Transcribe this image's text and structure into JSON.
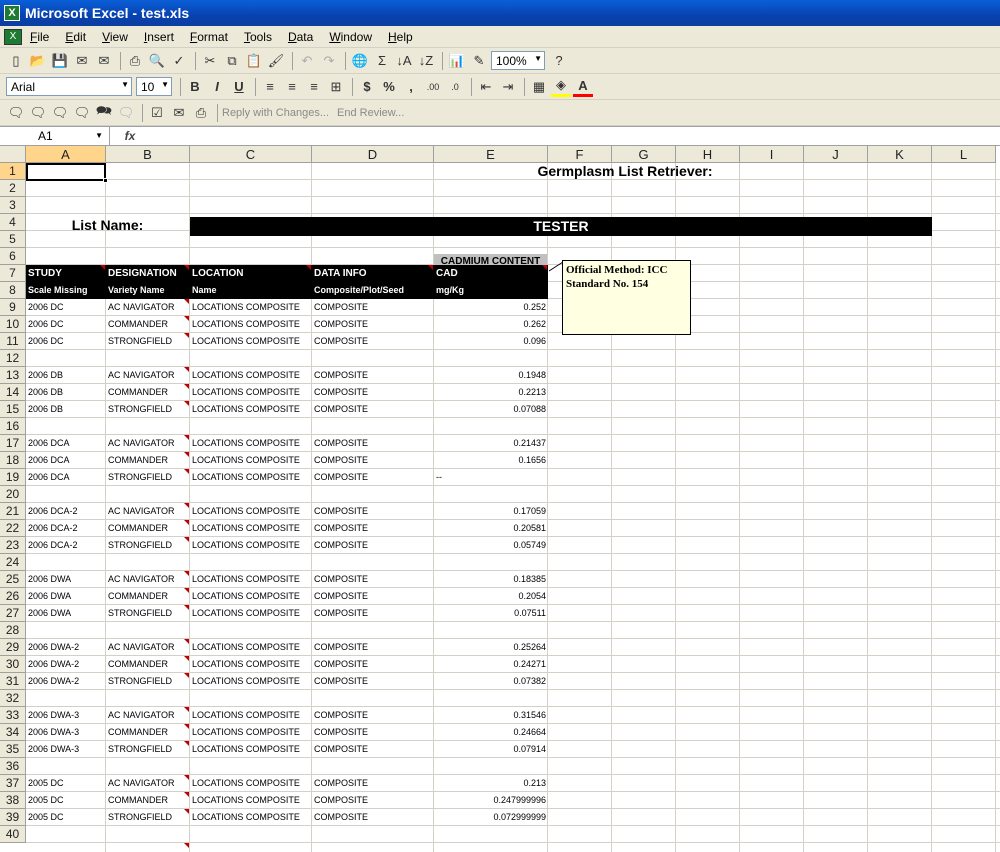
{
  "window": {
    "title": "Microsoft Excel - test.xls"
  },
  "menu": [
    "File",
    "Edit",
    "View",
    "Insert",
    "Format",
    "Tools",
    "Data",
    "Window",
    "Help"
  ],
  "toolbar": {
    "zoom": "100%",
    "font": "Arial",
    "font_size": "10",
    "bold": "B",
    "italic": "I",
    "underline": "U",
    "currency": "$",
    "percent": "%",
    "comma": ",",
    "sigma": "Σ",
    "reply_with_changes": "Reply with Changes...",
    "end_review": "End Review..."
  },
  "formula_bar": {
    "name_box": "A1",
    "fx": "fx",
    "value": ""
  },
  "columns": [
    "A",
    "B",
    "C",
    "D",
    "E",
    "F",
    "G",
    "H",
    "I",
    "J",
    "K",
    "L"
  ],
  "rows": [
    "1",
    "2",
    "3",
    "4",
    "5",
    "6",
    "7",
    "8",
    "9",
    "10",
    "11",
    "12",
    "13",
    "14",
    "15",
    "16",
    "17",
    "18",
    "19",
    "20",
    "21",
    "22",
    "23",
    "24",
    "25",
    "26",
    "27",
    "28",
    "29",
    "30",
    "31",
    "32",
    "33",
    "34",
    "35",
    "36",
    "37",
    "38",
    "39",
    "40"
  ],
  "sheet": {
    "title": "Germplasm List Retriever:",
    "list_name_label": "List Name:",
    "list_name_value": "TESTER",
    "group_header": "CADMIUM CONTENT",
    "headers_row7": [
      "STUDY",
      "DESIGNATION",
      "LOCATION",
      "DATA INFO",
      "CAD"
    ],
    "headers_row8": [
      "Scale Missing",
      "Variety Name",
      "Name",
      "Composite/Plot/Seed",
      "mg/Kg"
    ],
    "comment": {
      "line1": "Official Method: ICC",
      "line2": "Standard No. 154"
    },
    "data": [
      {
        "row": 9,
        "study": "2006 DC",
        "designation": "AC NAVIGATOR",
        "location": "LOCATIONS COMPOSITE",
        "info": "COMPOSITE",
        "cad": "0.252"
      },
      {
        "row": 10,
        "study": "2006 DC",
        "designation": "COMMANDER",
        "location": "LOCATIONS COMPOSITE",
        "info": "COMPOSITE",
        "cad": "0.262"
      },
      {
        "row": 11,
        "study": "2006 DC",
        "designation": "STRONGFIELD",
        "location": "LOCATIONS COMPOSITE",
        "info": "COMPOSITE",
        "cad": "0.096"
      },
      {
        "row": 13,
        "study": "2006 DB",
        "designation": "AC NAVIGATOR",
        "location": "LOCATIONS COMPOSITE",
        "info": "COMPOSITE",
        "cad": "0.1948"
      },
      {
        "row": 14,
        "study": "2006 DB",
        "designation": "COMMANDER",
        "location": "LOCATIONS COMPOSITE",
        "info": "COMPOSITE",
        "cad": "0.2213"
      },
      {
        "row": 15,
        "study": "2006 DB",
        "designation": "STRONGFIELD",
        "location": "LOCATIONS COMPOSITE",
        "info": "COMPOSITE",
        "cad": "0.07088"
      },
      {
        "row": 17,
        "study": "2006 DCA",
        "designation": "AC NAVIGATOR",
        "location": "LOCATIONS COMPOSITE",
        "info": "COMPOSITE",
        "cad": "0.21437"
      },
      {
        "row": 18,
        "study": "2006 DCA",
        "designation": "COMMANDER",
        "location": "LOCATIONS COMPOSITE",
        "info": "COMPOSITE",
        "cad": "0.1656"
      },
      {
        "row": 19,
        "study": "2006 DCA",
        "designation": "STRONGFIELD",
        "location": "LOCATIONS COMPOSITE",
        "info": "COMPOSITE",
        "cad": "--",
        "cad_left": true
      },
      {
        "row": 21,
        "study": "2006 DCA-2",
        "designation": "AC NAVIGATOR",
        "location": "LOCATIONS COMPOSITE",
        "info": "COMPOSITE",
        "cad": "0.17059"
      },
      {
        "row": 22,
        "study": "2006 DCA-2",
        "designation": "COMMANDER",
        "location": "LOCATIONS COMPOSITE",
        "info": "COMPOSITE",
        "cad": "0.20581"
      },
      {
        "row": 23,
        "study": "2006 DCA-2",
        "designation": "STRONGFIELD",
        "location": "LOCATIONS COMPOSITE",
        "info": "COMPOSITE",
        "cad": "0.05749"
      },
      {
        "row": 25,
        "study": "2006 DWA",
        "designation": "AC NAVIGATOR",
        "location": "LOCATIONS COMPOSITE",
        "info": "COMPOSITE",
        "cad": "0.18385"
      },
      {
        "row": 26,
        "study": "2006 DWA",
        "designation": "COMMANDER",
        "location": "LOCATIONS COMPOSITE",
        "info": "COMPOSITE",
        "cad": "0.2054"
      },
      {
        "row": 27,
        "study": "2006 DWA",
        "designation": "STRONGFIELD",
        "location": "LOCATIONS COMPOSITE",
        "info": "COMPOSITE",
        "cad": "0.07511"
      },
      {
        "row": 29,
        "study": "2006 DWA-2",
        "designation": "AC NAVIGATOR",
        "location": "LOCATIONS COMPOSITE",
        "info": "COMPOSITE",
        "cad": "0.25264"
      },
      {
        "row": 30,
        "study": "2006 DWA-2",
        "designation": "COMMANDER",
        "location": "LOCATIONS COMPOSITE",
        "info": "COMPOSITE",
        "cad": "0.24271"
      },
      {
        "row": 31,
        "study": "2006 DWA-2",
        "designation": "STRONGFIELD",
        "location": "LOCATIONS COMPOSITE",
        "info": "COMPOSITE",
        "cad": "0.07382"
      },
      {
        "row": 33,
        "study": "2006 DWA-3",
        "designation": "AC NAVIGATOR",
        "location": "LOCATIONS COMPOSITE",
        "info": "COMPOSITE",
        "cad": "0.31546"
      },
      {
        "row": 34,
        "study": "2006 DWA-3",
        "designation": "COMMANDER",
        "location": "LOCATIONS COMPOSITE",
        "info": "COMPOSITE",
        "cad": "0.24664"
      },
      {
        "row": 35,
        "study": "2006 DWA-3",
        "designation": "STRONGFIELD",
        "location": "LOCATIONS COMPOSITE",
        "info": "COMPOSITE",
        "cad": "0.07914"
      },
      {
        "row": 37,
        "study": "2005 DC",
        "designation": "AC NAVIGATOR",
        "location": "LOCATIONS COMPOSITE",
        "info": "COMPOSITE",
        "cad": "0.213"
      },
      {
        "row": 38,
        "study": "2005 DC",
        "designation": "COMMANDER",
        "location": "LOCATIONS COMPOSITE",
        "info": "COMPOSITE",
        "cad": "0.247999996"
      },
      {
        "row": 39,
        "study": "2005 DC",
        "designation": "STRONGFIELD",
        "location": "LOCATIONS COMPOSITE",
        "info": "COMPOSITE",
        "cad": "0.072999999"
      }
    ]
  }
}
